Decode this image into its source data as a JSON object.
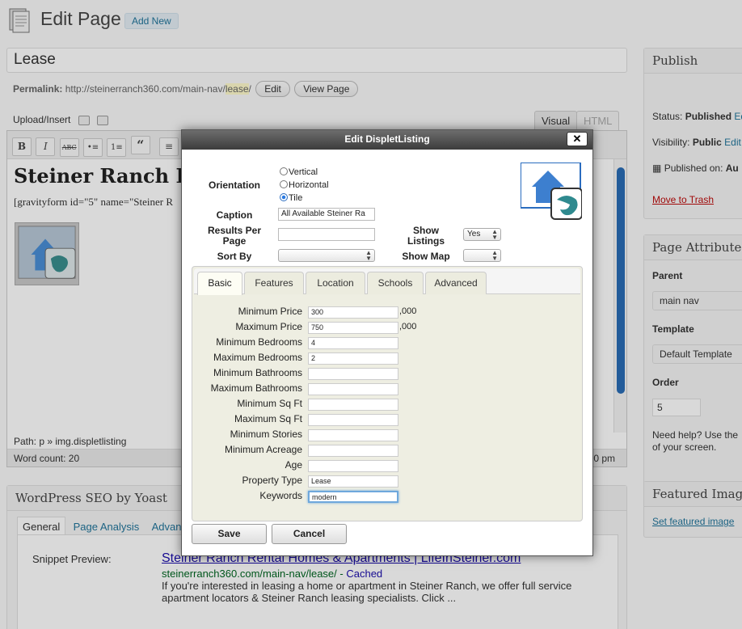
{
  "header": {
    "title": "Edit Page",
    "add_new": "Add New"
  },
  "post": {
    "title": "Lease",
    "permalink_label": "Permalink:",
    "permalink_base": "http://steinerranch360.com/main-nav/",
    "permalink_slug": "lease",
    "permalink_end": "/",
    "edit_button": "Edit",
    "view_button": "View Page"
  },
  "editor": {
    "upload_insert": "Upload/Insert",
    "tab_visual": "Visual",
    "tab_html": "HTML",
    "heading": "Steiner Ranch R",
    "shortcode": "[gravityform id=\"5\" name=\"Steiner R",
    "path": "Path: p » img.displetlisting",
    "word_count": "Word count: 20",
    "time_fragment": "0 pm",
    "toolbar": [
      "B",
      "I",
      "ABC",
      "•≡",
      "1≡",
      "“",
      "≡"
    ]
  },
  "seo": {
    "title": "WordPress SEO by Yoast",
    "tabs": [
      "General",
      "Page Analysis",
      "Advanced"
    ],
    "snippet_label": "Snippet Preview:",
    "snippet_title": "Steiner Ranch Rental Homes & Apartments | LifeInSteiner.com",
    "snippet_url": "steinerranch360.com/main-nav/lease/",
    "snippet_cached": "Cached",
    "snippet_desc": "If you're interested in leasing a home or apartment in Steiner Ranch, we offer full service apartment locators & Steiner Ranch leasing specialists. Click ..."
  },
  "sidebar": {
    "publish_title": "Publish",
    "status_label": "Status:",
    "status_value": "Published",
    "status_edit": "Ed",
    "visibility_label": "Visibility:",
    "visibility_value": "Public",
    "visibility_edit": "Edit",
    "published_on": "Published on:",
    "published_on_value": "Au",
    "move_to_trash": "Move to Trash",
    "page_attributes_title": "Page Attributes",
    "parent_label": "Parent",
    "parent_value": "main nav",
    "template_label": "Template",
    "template_value": "Default Template",
    "order_label": "Order",
    "order_value": "5",
    "help_text_1": "Need help? Use the",
    "help_text_2": "of your screen.",
    "featured_title": "Featured Image",
    "set_featured": "Set featured image"
  },
  "dialog": {
    "title": "Edit DispletListing",
    "close": "✕",
    "orientation_label": "Orientation",
    "orientation_options": [
      "Vertical",
      "Horizontal",
      "Tile"
    ],
    "orientation_selected": "Tile",
    "caption_label": "Caption",
    "caption_value": "All Available Steiner Ra",
    "results_per_page_label": "Results Per Page",
    "results_per_page_value": "",
    "show_listings_label": "Show Listings",
    "show_listings_value": "Yes",
    "sort_by_label": "Sort By",
    "sort_by_value": "",
    "show_map_label": "Show Map",
    "show_map_value": "",
    "tabs": [
      "Basic",
      "Features",
      "Location",
      "Schools",
      "Advanced"
    ],
    "active_tab": "Basic",
    "fields": [
      {
        "label": "Minimum Price",
        "value": "300",
        "suffix": ",000"
      },
      {
        "label": "Maximum Price",
        "value": "750",
        "suffix": ",000"
      },
      {
        "label": "Minimum Bedrooms",
        "value": "4",
        "suffix": ""
      },
      {
        "label": "Maximum Bedrooms",
        "value": "2",
        "suffix": ""
      },
      {
        "label": "Minimum Bathrooms",
        "value": "",
        "suffix": ""
      },
      {
        "label": "Maximum Bathrooms",
        "value": "",
        "suffix": ""
      },
      {
        "label": "Minimum Sq Ft",
        "value": "",
        "suffix": ""
      },
      {
        "label": "Maximum Sq Ft",
        "value": "",
        "suffix": ""
      },
      {
        "label": "Minimum Stories",
        "value": "",
        "suffix": ""
      },
      {
        "label": "Minimum Acreage",
        "value": "",
        "suffix": ""
      },
      {
        "label": "Age",
        "value": "",
        "suffix": ""
      },
      {
        "label": "Property Type",
        "value": "Lease",
        "suffix": ""
      },
      {
        "label": "Keywords",
        "value": "modern",
        "suffix": ""
      }
    ],
    "save": "Save",
    "cancel": "Cancel"
  },
  "icons": {
    "page": "page-icon",
    "logo": "house-pin-icon"
  },
  "colors": {
    "link": "#21759b",
    "trash": "#bc0b0b",
    "dialog_header": "#4a4a4a",
    "panel": "#eeeee2",
    "focus": "#6fa8dc"
  }
}
